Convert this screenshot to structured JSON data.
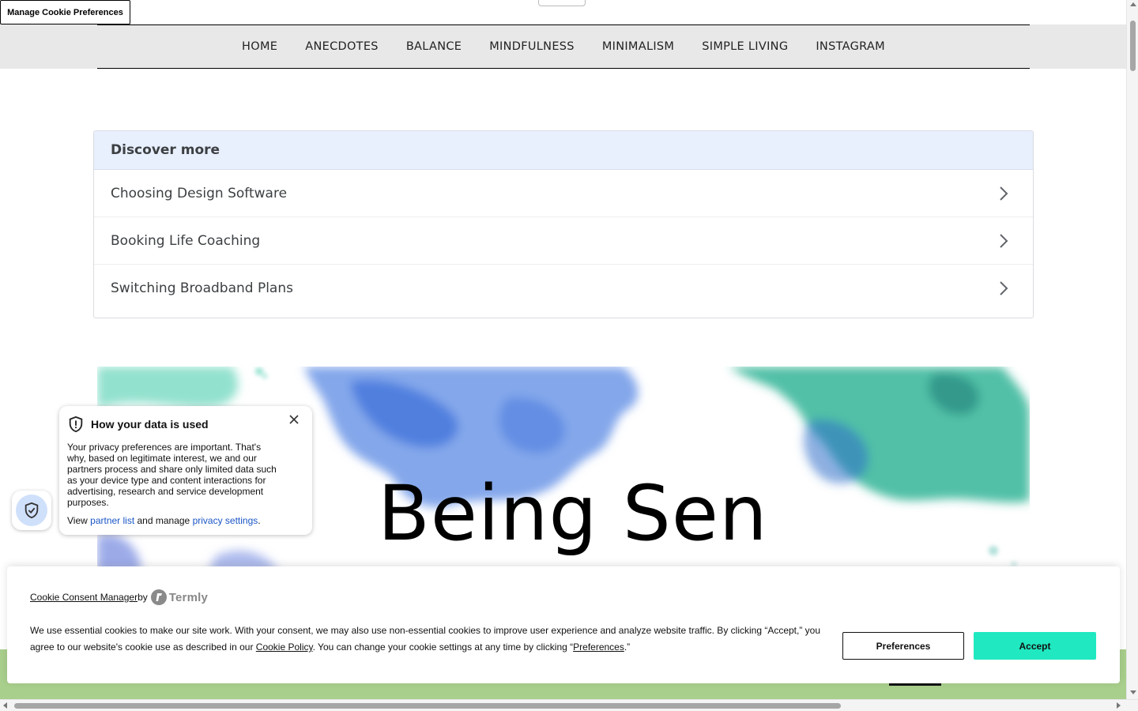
{
  "manage_cookie": {
    "label": "Manage Cookie Preferences"
  },
  "nav": {
    "items": [
      "HOME",
      "ANECDOTES",
      "BALANCE",
      "MINDFULNESS",
      "MINIMALISM",
      "SIMPLE LIVING",
      "INSTAGRAM"
    ]
  },
  "discover": {
    "title": "Discover more",
    "items": [
      "Choosing Design Software",
      "Booking Life Coaching",
      "Switching Broadband Plans"
    ]
  },
  "hero": {
    "title": "Being Sen"
  },
  "privacy_popup": {
    "title": "How your data is used",
    "body": "Your privacy preferences are important. That's why, based on legitimate interest, we and our partners process and share only limited data such as your device type and content interactions for advertising, research and service development purposes.",
    "footer_prefix": "View ",
    "partner_link": "partner list",
    "footer_middle": " and manage ",
    "settings_link": "privacy settings",
    "footer_suffix": "."
  },
  "cookie_banner": {
    "brand_link": "Cookie Consent Manager",
    "brand_by": " by",
    "brand_name": "Termly",
    "text_part1": "We use essential cookies to make our site work. With your consent, we may also use non-essential cookies to improve user experience and analyze website traffic. By clicking “Accept,” you agree to our website's cookie use as described in our ",
    "cookie_policy_link": "Cookie Policy",
    "text_part2": ". You can change your cookie settings at any time by clicking “",
    "preferences_link": "Preferences",
    "text_part3": ".”",
    "preferences_button": "Preferences",
    "accept_button": "Accept"
  },
  "colors": {
    "accept": "#20e8c1",
    "nav_bg": "#e8e8e8",
    "discover_header": "#e8effd",
    "link": "#1a56c6",
    "footer_green": "#a9cf8c"
  },
  "icons": {
    "popup_shield": "shield-icon",
    "popup_close": "close-icon",
    "badge": "shield-check-icon",
    "row_chevron": "chevron-right-icon",
    "termly": "termly-logo-icon"
  }
}
